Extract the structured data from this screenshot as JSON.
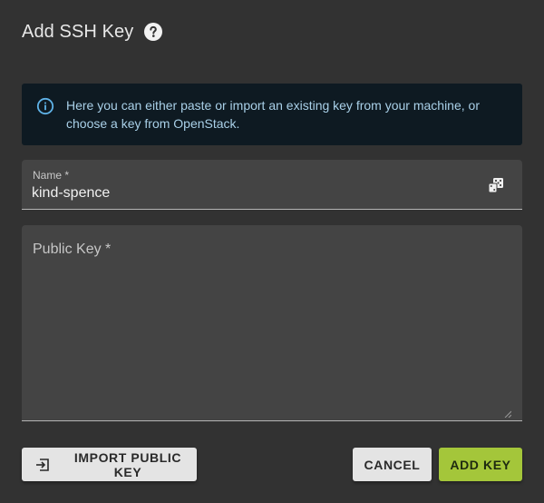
{
  "dialog": {
    "title": "Add SSH Key",
    "help_icon": "help-circle-icon"
  },
  "info": {
    "icon": "info-circle-icon",
    "text_line1": "Here you can either paste or import an existing key from your machine, or",
    "text_line2": "choose a key from OpenStack."
  },
  "name_field": {
    "label": "Name *",
    "value": "kind-spence",
    "generate_icon": "dice-icon"
  },
  "public_key_field": {
    "label": "Public Key *",
    "value": ""
  },
  "actions": {
    "import_label": "IMPORT PUBLIC KEY",
    "import_icon": "import-icon",
    "cancel_label": "CANCEL",
    "add_label": "ADD KEY"
  },
  "colors": {
    "background": "#323232",
    "info_background": "#0e1a22",
    "info_accent": "#5fb3e8",
    "primary_button": "#a4c63a",
    "secondary_button": "#e4e4e4"
  }
}
